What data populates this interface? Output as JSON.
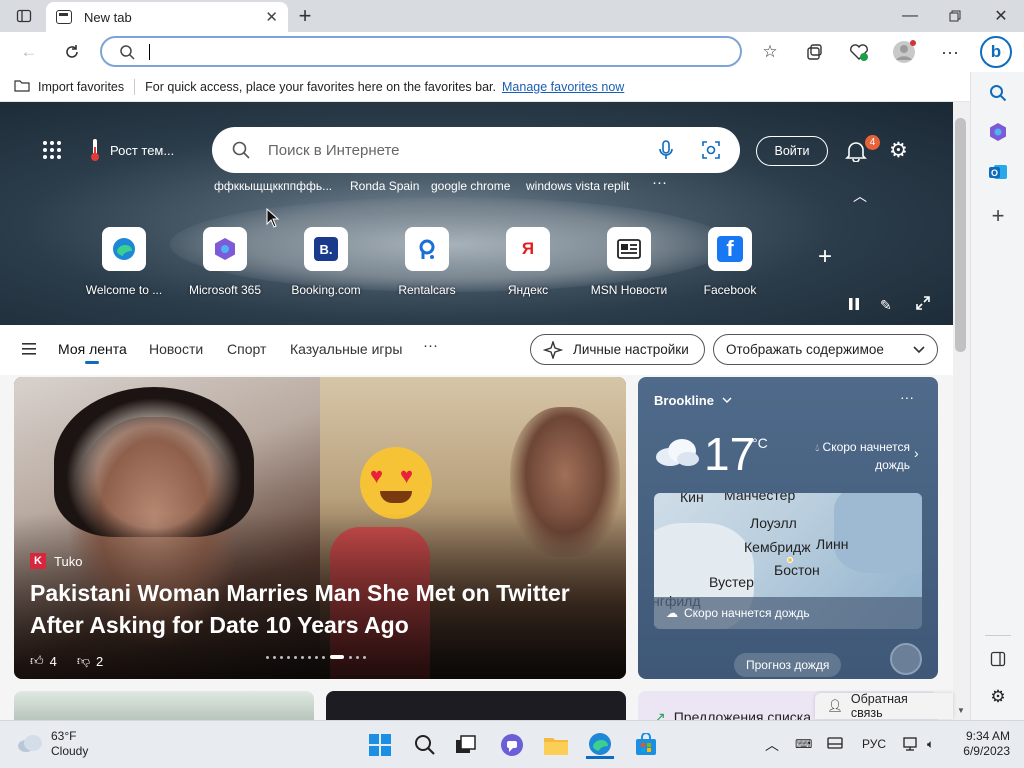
{
  "tab": {
    "title": "New tab"
  },
  "favorites_bar": {
    "import_label": "Import favorites",
    "prompt": "For quick access, place your favorites here on the favorites bar.",
    "manage_link": "Manage favorites now"
  },
  "hero": {
    "weather_chip": "Рост тем...",
    "search_placeholder": "Поиск в Интернете",
    "signin_label": "Войти",
    "notifications_count": "4",
    "trending": [
      "ффккыщщккппффь...",
      "Ronda Spain",
      "google chrome",
      "windows vista replit"
    ],
    "quick_links": [
      {
        "label": "Welcome to ...",
        "icon": "edge-icon"
      },
      {
        "label": "Microsoft 365",
        "icon": "m365-icon"
      },
      {
        "label": "Booking.com",
        "icon": "booking-icon"
      },
      {
        "label": "Rentalcars",
        "icon": "rentalcars-icon"
      },
      {
        "label": "Яндекс",
        "icon": "yandex-icon"
      },
      {
        "label": "MSN Новости",
        "icon": "msn-news-icon"
      },
      {
        "label": "Facebook",
        "icon": "facebook-icon"
      }
    ]
  },
  "nav": {
    "tabs": [
      "Моя лента",
      "Новости",
      "Спорт",
      "Казуальные игры"
    ],
    "personalize_label": "Личные настройки",
    "display_content_label": "Отображать содержимое"
  },
  "hero_story": {
    "source": "Tuko",
    "headline": "Pakistani Woman Marries Man She Met on Twitter After Asking for Date 10 Years Ago",
    "likes": "4",
    "dislikes": "2"
  },
  "weather_card": {
    "location": "Brookline",
    "temp": "17",
    "unit": "°C",
    "forecast_line1": "Скоро начнется",
    "forecast_line2": "дождь",
    "map_labels": [
      "Кин",
      "Манчестер",
      "Лоуэлл",
      "Кембридж",
      "Линн",
      "Вустер",
      "Бостон",
      "нгфилд"
    ],
    "map_caption": "Скоро начнется дождь",
    "button_label": "Прогноз дождя"
  },
  "bottom": {
    "suggestion_text": "Предложения списка",
    "feedback_label": "Обратная связь"
  },
  "taskbar": {
    "weather_temp": "63°F",
    "weather_desc": "Cloudy",
    "language": "РУС",
    "time": "9:34 AM",
    "date": "6/9/2023"
  },
  "colors": {
    "accent": "#0f6cbd",
    "hero_bg": "#2b3c4a",
    "weather_card": "#4f6a8a"
  }
}
